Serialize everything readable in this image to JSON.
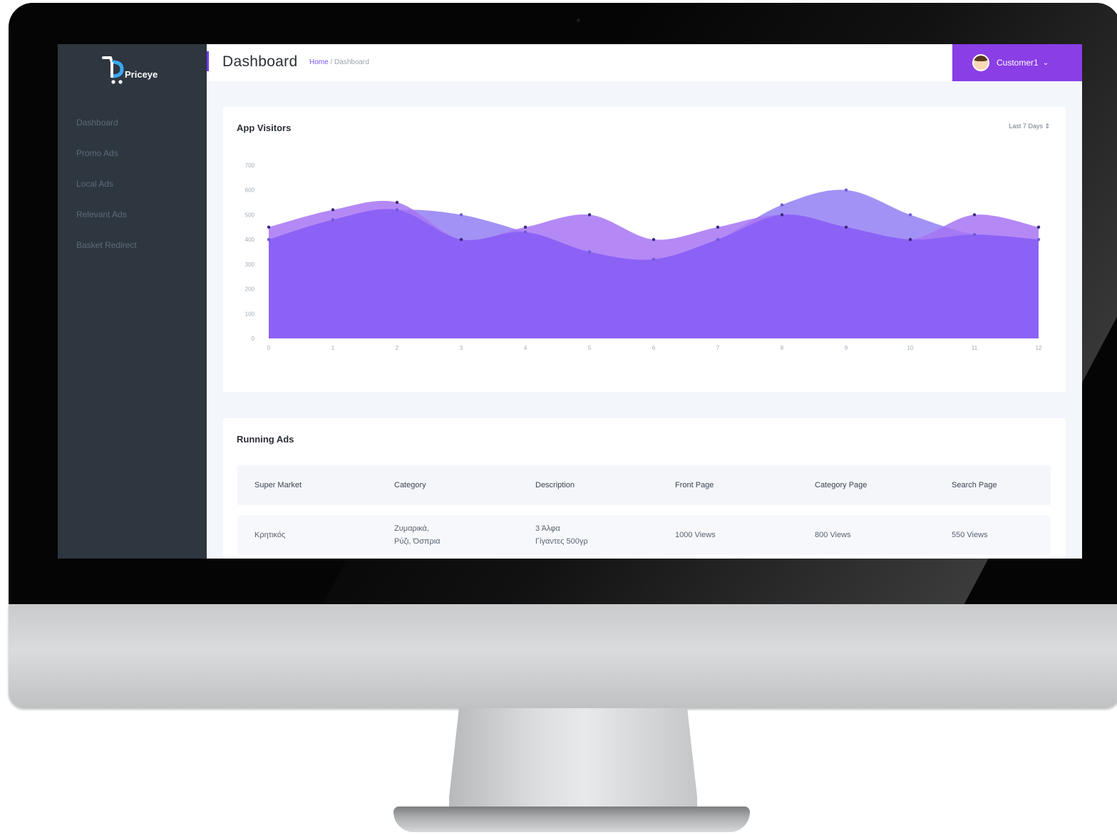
{
  "app": {
    "name": "Priceye"
  },
  "sidebar": {
    "items": [
      {
        "label": "Dashboard"
      },
      {
        "label": "Promo Ads"
      },
      {
        "label": "Local Ads"
      },
      {
        "label": "Relevant Ads"
      },
      {
        "label": "Basket Redirect"
      }
    ]
  },
  "header": {
    "title": "Dashboard",
    "breadcrumb_home": "Home",
    "breadcrumb_sep": " / ",
    "breadcrumb_current": "Dashboard",
    "user_name": "Customer1",
    "accent_color": "#8a3ee6"
  },
  "visitors_card": {
    "title": "App Visitors",
    "range_label": "Last 7 Days ⇕"
  },
  "chart_data": {
    "type": "area",
    "title": "App Visitors",
    "x": [
      0,
      1,
      2,
      3,
      4,
      5,
      6,
      7,
      8,
      9,
      10,
      11,
      12
    ],
    "ylim": [
      0,
      700
    ],
    "yticks": [
      0,
      100,
      200,
      300,
      400,
      500,
      600,
      700
    ],
    "grid": false,
    "series": [
      {
        "color": "#9e8cf4",
        "values": [
          400,
          480,
          520,
          500,
          430,
          350,
          320,
          400,
          540,
          600,
          500,
          420,
          400
        ]
      },
      {
        "color": "#a774f3",
        "values": [
          450,
          520,
          550,
          400,
          450,
          500,
          400,
          450,
          500,
          450,
          400,
          500,
          450
        ]
      }
    ]
  },
  "ads_card": {
    "title": "Running Ads",
    "columns": [
      "Super Market",
      "Category",
      "Description",
      "Front Page",
      "Category Page",
      "Search Page"
    ],
    "rows": [
      {
        "super_market": "Κρητικός",
        "category": "Ζυμαρικά,\nΡύζι, Όσπρια",
        "description": "3 Άλφα\nΓίγαντες 500γρ",
        "front_page": "1000 Views",
        "category_page": "800 Views",
        "search_page": "550 Views"
      }
    ]
  }
}
